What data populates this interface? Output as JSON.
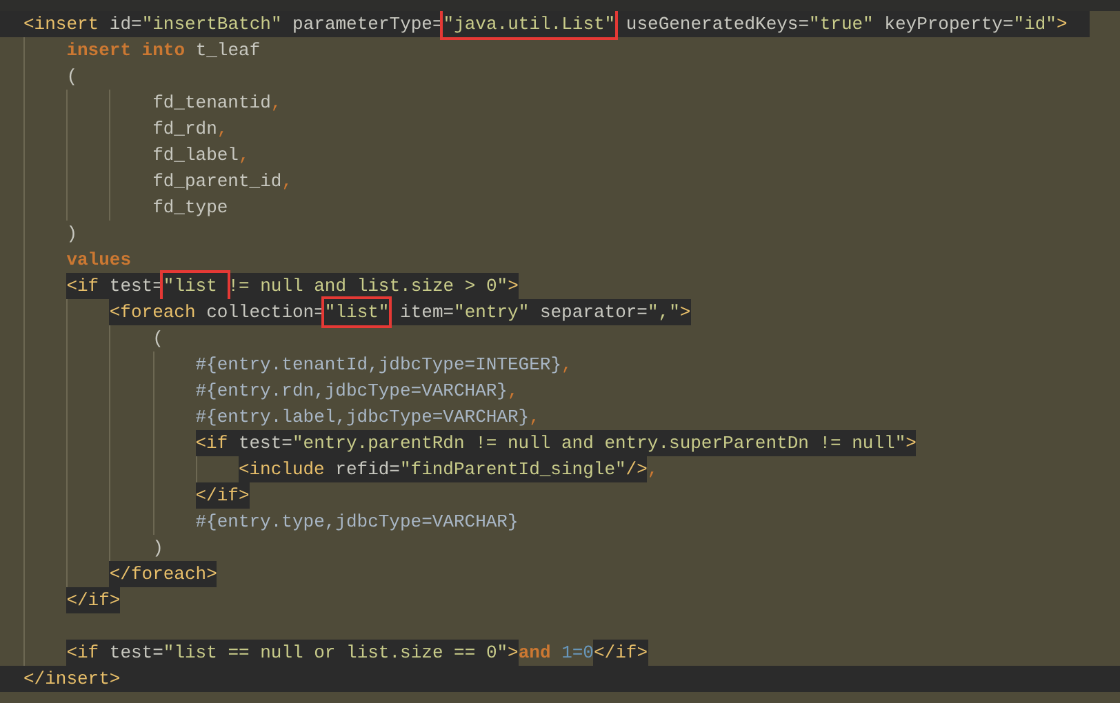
{
  "editor": {
    "lines": [
      {
        "kind": "line",
        "band": true,
        "segments": [
          {
            "kind": "xml",
            "tokens": [
              {
                "kind": "tag",
                "text": "<insert",
                "boxed": false
              },
              {
                "kind": "attr",
                "text": " id=",
                "boxed": false
              },
              {
                "kind": "str",
                "text": "\"insertBatch\"",
                "boxed": false
              },
              {
                "kind": "attr",
                "text": " parameterType=",
                "boxed": false
              },
              {
                "kind": "str",
                "text": "\"java.util.List\"",
                "boxed": true
              },
              {
                "kind": "attr",
                "text": " useGeneratedKeys=",
                "boxed": false
              },
              {
                "kind": "str",
                "text": "\"true\"",
                "boxed": false
              },
              {
                "kind": "attr",
                "text": " keyProperty=",
                "boxed": false
              },
              {
                "kind": "str",
                "text": "\"id\"",
                "boxed": false
              },
              {
                "kind": "tag",
                "text": ">",
                "boxed": false
              }
            ]
          }
        ],
        "children": [
          {
            "kind": "line",
            "band": false,
            "segments": [
              {
                "kind": "sql",
                "tokens": [
                  {
                    "kind": "kw",
                    "text": "insert into",
                    "boxed": false
                  },
                  {
                    "kind": "text",
                    "text": " t_leaf",
                    "boxed": false
                  }
                ]
              }
            ]
          },
          {
            "kind": "line",
            "band": false,
            "segments": [
              {
                "kind": "sql",
                "tokens": [
                  {
                    "kind": "text",
                    "text": "(",
                    "boxed": false
                  }
                ]
              }
            ],
            "children": [
              {
                "kind": "group",
                "children": [
                  {
                    "kind": "line",
                    "band": false,
                    "segments": [
                      {
                        "kind": "sql",
                        "tokens": [
                          {
                            "kind": "text",
                            "text": "fd_tenantid",
                            "boxed": false
                          },
                          {
                            "kind": "punct",
                            "text": ",",
                            "boxed": false
                          }
                        ]
                      }
                    ]
                  },
                  {
                    "kind": "line",
                    "band": false,
                    "segments": [
                      {
                        "kind": "sql",
                        "tokens": [
                          {
                            "kind": "text",
                            "text": "fd_rdn",
                            "boxed": false
                          },
                          {
                            "kind": "punct",
                            "text": ",",
                            "boxed": false
                          }
                        ]
                      }
                    ]
                  },
                  {
                    "kind": "line",
                    "band": false,
                    "segments": [
                      {
                        "kind": "sql",
                        "tokens": [
                          {
                            "kind": "text",
                            "text": "fd_label",
                            "boxed": false
                          },
                          {
                            "kind": "punct",
                            "text": ",",
                            "boxed": false
                          }
                        ]
                      }
                    ]
                  },
                  {
                    "kind": "line",
                    "band": false,
                    "segments": [
                      {
                        "kind": "sql",
                        "tokens": [
                          {
                            "kind": "text",
                            "text": "fd_parent_id",
                            "boxed": false
                          },
                          {
                            "kind": "punct",
                            "text": ",",
                            "boxed": false
                          }
                        ]
                      }
                    ]
                  },
                  {
                    "kind": "line",
                    "band": false,
                    "segments": [
                      {
                        "kind": "sql",
                        "tokens": [
                          {
                            "kind": "text",
                            "text": "fd_type",
                            "boxed": false
                          }
                        ]
                      }
                    ]
                  }
                ]
              }
            ]
          },
          {
            "kind": "line",
            "band": false,
            "segments": [
              {
                "kind": "sql",
                "tokens": [
                  {
                    "kind": "text",
                    "text": ")",
                    "boxed": false
                  }
                ]
              }
            ]
          },
          {
            "kind": "line",
            "band": false,
            "segments": [
              {
                "kind": "sql",
                "tokens": [
                  {
                    "kind": "kw",
                    "text": "values",
                    "boxed": false
                  }
                ]
              }
            ]
          },
          {
            "kind": "line",
            "band": false,
            "segments": [
              {
                "kind": "xml",
                "tokens": [
                  {
                    "kind": "tag",
                    "text": "<if",
                    "boxed": false
                  },
                  {
                    "kind": "attr",
                    "text": " test=",
                    "boxed": false
                  },
                  {
                    "kind": "str",
                    "text": "\"list ",
                    "boxed": true
                  },
                  {
                    "kind": "str",
                    "text": "!= null and list.size > 0\"",
                    "boxed": false
                  },
                  {
                    "kind": "tag",
                    "text": ">",
                    "boxed": false
                  }
                ]
              }
            ],
            "children": [
              {
                "kind": "line",
                "band": false,
                "segments": [
                  {
                    "kind": "xml",
                    "tokens": [
                      {
                        "kind": "tag",
                        "text": "<foreach",
                        "boxed": false
                      },
                      {
                        "kind": "attr",
                        "text": " collection=",
                        "boxed": false
                      },
                      {
                        "kind": "str",
                        "text": "\"list\"",
                        "boxed": true
                      },
                      {
                        "kind": "attr",
                        "text": " item=",
                        "boxed": false
                      },
                      {
                        "kind": "str",
                        "text": "\"entry\"",
                        "boxed": false
                      },
                      {
                        "kind": "attr",
                        "text": " separator=",
                        "boxed": false
                      },
                      {
                        "kind": "str",
                        "text": "\",\"",
                        "boxed": false
                      },
                      {
                        "kind": "tag",
                        "text": ">",
                        "boxed": false
                      }
                    ]
                  }
                ],
                "children": [
                  {
                    "kind": "line",
                    "band": false,
                    "segments": [
                      {
                        "kind": "sql",
                        "tokens": [
                          {
                            "kind": "text",
                            "text": "(",
                            "boxed": false
                          }
                        ]
                      }
                    ],
                    "children": [
                      {
                        "kind": "line",
                        "band": false,
                        "segments": [
                          {
                            "kind": "sql",
                            "tokens": [
                              {
                                "kind": "param",
                                "text": "#{entry.tenantId,jdbcType=INTEGER}",
                                "boxed": false
                              },
                              {
                                "kind": "punct",
                                "text": ",",
                                "boxed": false
                              }
                            ]
                          }
                        ]
                      },
                      {
                        "kind": "line",
                        "band": false,
                        "segments": [
                          {
                            "kind": "sql",
                            "tokens": [
                              {
                                "kind": "param",
                                "text": "#{entry.rdn,jdbcType=VARCHAR}",
                                "boxed": false
                              },
                              {
                                "kind": "punct",
                                "text": ",",
                                "boxed": false
                              }
                            ]
                          }
                        ]
                      },
                      {
                        "kind": "line",
                        "band": false,
                        "segments": [
                          {
                            "kind": "sql",
                            "tokens": [
                              {
                                "kind": "param",
                                "text": "#{entry.label,jdbcType=VARCHAR}",
                                "boxed": false
                              },
                              {
                                "kind": "punct",
                                "text": ",",
                                "boxed": false
                              }
                            ]
                          }
                        ]
                      },
                      {
                        "kind": "line",
                        "band": false,
                        "segments": [
                          {
                            "kind": "xml",
                            "tokens": [
                              {
                                "kind": "tag",
                                "text": "<if",
                                "boxed": false
                              },
                              {
                                "kind": "attr",
                                "text": " test=",
                                "boxed": false
                              },
                              {
                                "kind": "str",
                                "text": "\"entry.parentRdn != null and entry.superParentDn != null\"",
                                "boxed": false
                              },
                              {
                                "kind": "tag",
                                "text": ">",
                                "boxed": false
                              }
                            ]
                          }
                        ],
                        "children": [
                          {
                            "kind": "line",
                            "band": false,
                            "segments": [
                              {
                                "kind": "xml",
                                "tokens": [
                                  {
                                    "kind": "tag",
                                    "text": "<include",
                                    "boxed": false
                                  },
                                  {
                                    "kind": "attr",
                                    "text": " refid=",
                                    "boxed": false
                                  },
                                  {
                                    "kind": "str",
                                    "text": "\"findParentId_single\"",
                                    "boxed": false
                                  },
                                  {
                                    "kind": "tag",
                                    "text": "/>",
                                    "boxed": false
                                  }
                                ]
                              },
                              {
                                "kind": "sql",
                                "tokens": [
                                  {
                                    "kind": "punct",
                                    "text": ",",
                                    "boxed": false
                                  }
                                ]
                              }
                            ]
                          }
                        ]
                      },
                      {
                        "kind": "line",
                        "band": false,
                        "segments": [
                          {
                            "kind": "xml",
                            "tokens": [
                              {
                                "kind": "tag",
                                "text": "</if>",
                                "boxed": false
                              }
                            ]
                          }
                        ]
                      },
                      {
                        "kind": "line",
                        "band": false,
                        "segments": [
                          {
                            "kind": "sql",
                            "tokens": [
                              {
                                "kind": "param",
                                "text": "#{entry.type,jdbcType=VARCHAR}",
                                "boxed": false
                              }
                            ]
                          }
                        ]
                      }
                    ]
                  },
                  {
                    "kind": "line",
                    "band": false,
                    "segments": [
                      {
                        "kind": "sql",
                        "tokens": [
                          {
                            "kind": "text",
                            "text": ")",
                            "boxed": false
                          }
                        ]
                      }
                    ]
                  }
                ]
              },
              {
                "kind": "line",
                "band": false,
                "segments": [
                  {
                    "kind": "xml",
                    "tokens": [
                      {
                        "kind": "tag",
                        "text": "</foreach>",
                        "boxed": false
                      }
                    ]
                  }
                ]
              }
            ]
          },
          {
            "kind": "line",
            "band": false,
            "segments": [
              {
                "kind": "xml",
                "tokens": [
                  {
                    "kind": "tag",
                    "text": "</if>",
                    "boxed": false
                  }
                ]
              }
            ]
          },
          {
            "kind": "blank",
            "band": false
          },
          {
            "kind": "line",
            "band": false,
            "segments": [
              {
                "kind": "xml",
                "tokens": [
                  {
                    "kind": "tag",
                    "text": "<if",
                    "boxed": false
                  },
                  {
                    "kind": "attr",
                    "text": " test=",
                    "boxed": false
                  },
                  {
                    "kind": "str",
                    "text": "\"list == null or list.size == 0\"",
                    "boxed": false
                  },
                  {
                    "kind": "tag",
                    "text": ">",
                    "boxed": false
                  }
                ]
              },
              {
                "kind": "sql",
                "tokens": [
                  {
                    "kind": "kw",
                    "text": "and",
                    "boxed": false
                  },
                  {
                    "kind": "num",
                    "text": " 1=0",
                    "boxed": false
                  }
                ]
              },
              {
                "kind": "xml",
                "tokens": [
                  {
                    "kind": "tag",
                    "text": "</if>",
                    "boxed": false
                  }
                ]
              }
            ]
          }
        ]
      },
      {
        "kind": "line",
        "band": true,
        "segments": [
          {
            "kind": "xml",
            "tokens": [
              {
                "kind": "tag",
                "text": "</insert>",
                "boxed": false
              }
            ]
          }
        ]
      }
    ]
  }
}
